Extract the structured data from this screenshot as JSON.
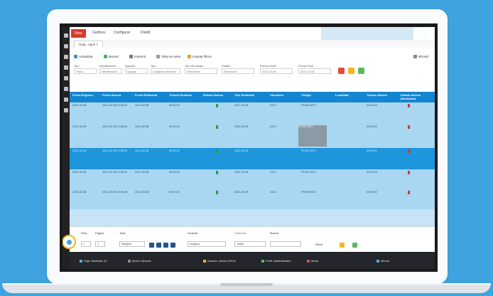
{
  "toolbar": {
    "file": "Files",
    "tab1": "Gráficos",
    "tab2": "Configurar",
    "tab3": "Dividir"
  },
  "document_tab": {
    "label": "Hoja - rojos"
  },
  "ribbon": {
    "buttons": [
      "Actualizar",
      "Buscar",
      "Imprimir",
      "Vista en serie",
      "Limpiar filtros",
      "Wizard"
    ],
    "filters": [
      {
        "label": "Tipo",
        "value": "Todos"
      },
      {
        "label": "Identificación",
        "value": "Identificación"
      },
      {
        "label": "Agrupar",
        "value": "Agrupar"
      },
      {
        "label": "Tipo",
        "value": "Cualquier selección"
      },
      {
        "label": "Tipo de estado",
        "value": "Seleccione"
      },
      {
        "label": "Estado",
        "value": "Seleccione"
      },
      {
        "label": "Fecha Inicial",
        "value": "2021-02-08"
      },
      {
        "label": "Fecha Final",
        "value": "2021-02-08"
      }
    ]
  },
  "grid": {
    "columns": [
      "Fecha Registro",
      "Fecha Alarma",
      "Fecha Realizada",
      "Tiempo Restante",
      "Estado Alarma",
      "Tipo Realizado",
      "Ubicación",
      "Código",
      "Localidad",
      "Tiempo Alarma",
      "Estado Alarma (Realizada)"
    ],
    "rows": [
      [
        "2021-02-08",
        "2021-02-08 07:55:00",
        "2021-02-08",
        "00:00:15",
        "green",
        "2021-02-08",
        "2410",
        "PP405-0071",
        "",
        "00:00:00",
        "red"
      ],
      [
        "2021-02-08",
        "2021-02-08 07:55:00",
        "2021-02-08",
        "00:00:15",
        "green",
        "2021-02-08",
        "2410",
        "PP405-0071",
        "",
        "00:00:00",
        "red"
      ],
      [
        "2021-02-08",
        "2021-02-08 07:55:00",
        "2021-02-08",
        "00:00:15",
        "green",
        "2021-02-08",
        "2410",
        "PP405-0071",
        "",
        "00:00:00",
        "red"
      ],
      [
        "2021-02-08",
        "2021-02-08 07:55:00",
        "2021-02-08",
        "00:00:15",
        "green",
        "2021-02-08",
        "2410",
        "PP405-0071",
        "",
        "00:00:00",
        "red"
      ],
      [
        "2021-02-08",
        "2021-02-08 07:55:00",
        "2021-02-08",
        "00:00:15",
        "green",
        "2021-02-08",
        "2410",
        "PP405-0071",
        "",
        "00:00:00",
        "red"
      ]
    ],
    "highlight_label": "PP405-0071"
  },
  "pager": {
    "rows_label": "Filas",
    "page_label": "Página",
    "total_label": "Total",
    "column_label": "Columna",
    "sort_label": "Ordenar",
    "search_label": "Buscar",
    "filter_label": "Filtrar",
    "sort_value": "Ninguno",
    "column_value": "Todas",
    "row_value": "1",
    "page_value": "1"
  },
  "status": {
    "items": [
      "Hoja: Estándar (1)",
      "Modo: Ejemplo",
      "Usuario: admin (2019)",
      "Perfil: Administrador",
      "Modo",
      "Idioma"
    ]
  },
  "colors": {
    "accent": "#1486d1",
    "selected_row": "#1d96dc",
    "row": "#a9d6f1",
    "file_button": "#d63b2a",
    "background": "#3ea3de"
  }
}
